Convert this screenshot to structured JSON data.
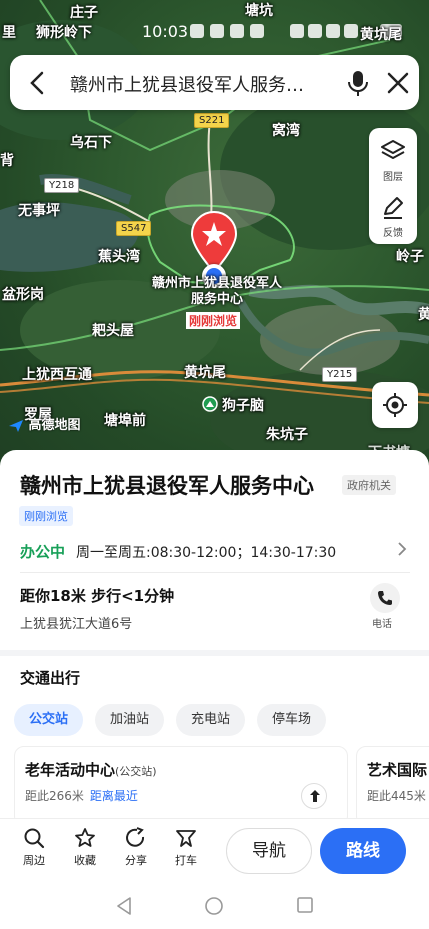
{
  "status_bar": {
    "time": "10:03"
  },
  "search": {
    "query": "赣州市上犹县退役军人服务…"
  },
  "map_tools": {
    "layers_label": "图层",
    "feedback_label": "反馈"
  },
  "map": {
    "logo": "高德地图",
    "poi_label": "赣州市上犹县退役军人服务中心",
    "poi_viewed": "刚刚浏览",
    "labels": [
      "庄子",
      "里",
      "狮形岭下",
      "塘坑",
      "黄坑尾",
      "乌石下",
      "窝湾",
      "背",
      "无事坪",
      "蕉头湾",
      "岭子",
      "盆形岗",
      "耙头屋",
      "上犹西互通",
      "黄坑尾",
      "狗子脑",
      "罗屋",
      "塘埠前",
      "朱坑子",
      "黄",
      "下书塘"
    ],
    "roads": [
      "S221",
      "Y218",
      "S547",
      "Y215"
    ]
  },
  "poi": {
    "title": "赣州市上犹县退役军人服务中心",
    "category": "政府机关",
    "recent_tag": "刚刚浏览",
    "open_status": "办公中",
    "hours": "周一至周五:08:30-12:00；14:30-17:30",
    "distance": "距你18米  步行<1分钟",
    "address": "上犹县犹江大道6号",
    "phone_label": "电话"
  },
  "transit": {
    "title": "交通出行",
    "chips": [
      "公交站",
      "加油站",
      "充电站",
      "停车场"
    ],
    "cards": [
      {
        "name": "老年活动中心",
        "suffix": "(公交站)",
        "distance": "距此266米",
        "note": "距离最近"
      },
      {
        "name": "艺术国际",
        "suffix": "",
        "distance": "距此445米",
        "note": ""
      }
    ]
  },
  "actions": {
    "nearby": "周边",
    "favorite": "收藏",
    "share": "分享",
    "taxi": "打车",
    "navigate": "导航",
    "route": "路线"
  }
}
